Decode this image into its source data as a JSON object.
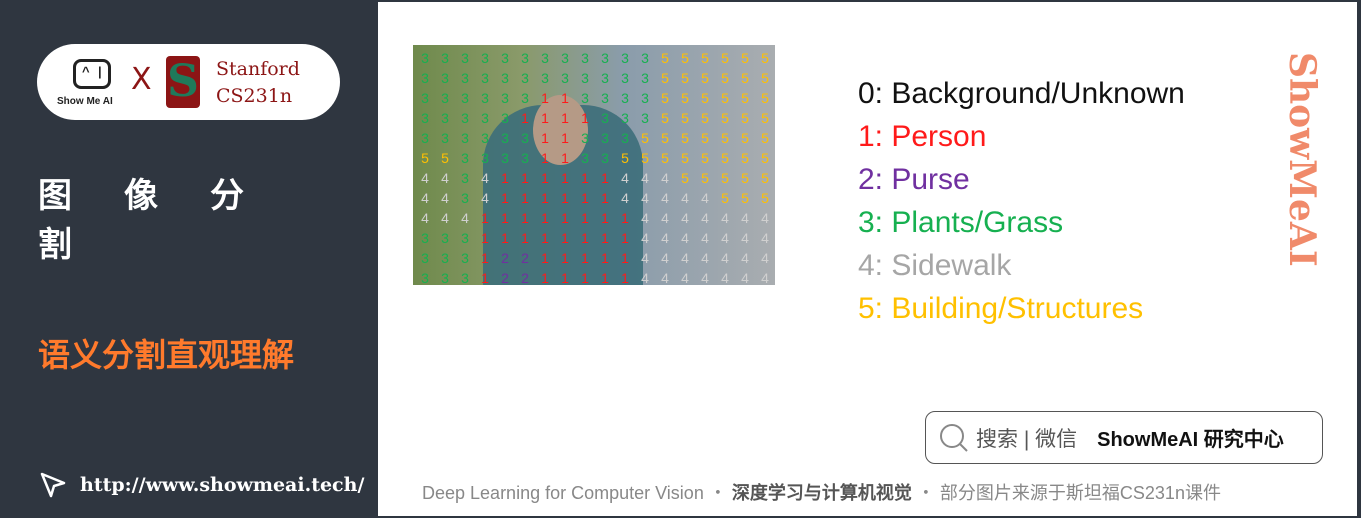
{
  "sidebar": {
    "logo": {
      "showmeai": "Show Me AI",
      "x": "X",
      "stanford": "Stanford",
      "course": "CS231n"
    },
    "title": "图像分割",
    "subtitle": "语义分割直观理解",
    "url": "http://www.showmeai.tech/"
  },
  "legend": [
    {
      "label": "0: Background/Unknown",
      "color": "#111111"
    },
    {
      "label": "1: Person",
      "color": "#ff1a1a"
    },
    {
      "label": "2: Purse",
      "color": "#7030a0"
    },
    {
      "label": "3: Plants/Grass",
      "color": "#16b050"
    },
    {
      "label": "4: Sidewalk",
      "color": "#a6a6a6"
    },
    {
      "label": "5: Building/Structures",
      "color": "#ffc000"
    }
  ],
  "grid": [
    "333333333333555555",
    "333333333333555555",
    "333333113333555555",
    "333331111333555555",
    "333333113335555555",
    "553333113355555555",
    "443411111144455555",
    "443411111144444555",
    "444111111114444444",
    "333111111114444444",
    "333122111114444444",
    "333122111114444444"
  ],
  "watermark": "ShowMeAI",
  "search": {
    "icon": "search-icon",
    "text": "搜索 | 微信",
    "brand": "ShowMeAI 研究中心"
  },
  "footer": {
    "en": "Deep Learning for Computer Vision",
    "sep": "・",
    "cn": "深度学习与计算机视觉",
    "note": "部分图片来源于斯坦福CS231n课件"
  }
}
